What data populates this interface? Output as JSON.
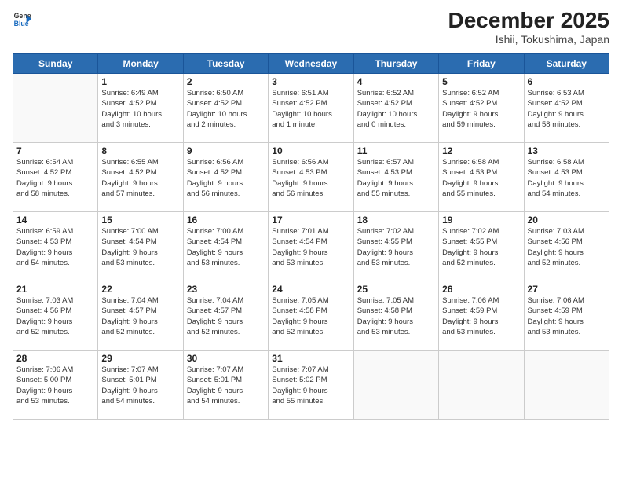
{
  "logo": {
    "line1": "General",
    "line2": "Blue",
    "icon": "▶"
  },
  "title": "December 2025",
  "subtitle": "Ishii, Tokushima, Japan",
  "days_of_week": [
    "Sunday",
    "Monday",
    "Tuesday",
    "Wednesday",
    "Thursday",
    "Friday",
    "Saturday"
  ],
  "weeks": [
    [
      {
        "day": "",
        "info": ""
      },
      {
        "day": "1",
        "info": "Sunrise: 6:49 AM\nSunset: 4:52 PM\nDaylight: 10 hours\nand 3 minutes."
      },
      {
        "day": "2",
        "info": "Sunrise: 6:50 AM\nSunset: 4:52 PM\nDaylight: 10 hours\nand 2 minutes."
      },
      {
        "day": "3",
        "info": "Sunrise: 6:51 AM\nSunset: 4:52 PM\nDaylight: 10 hours\nand 1 minute."
      },
      {
        "day": "4",
        "info": "Sunrise: 6:52 AM\nSunset: 4:52 PM\nDaylight: 10 hours\nand 0 minutes."
      },
      {
        "day": "5",
        "info": "Sunrise: 6:52 AM\nSunset: 4:52 PM\nDaylight: 9 hours\nand 59 minutes."
      },
      {
        "day": "6",
        "info": "Sunrise: 6:53 AM\nSunset: 4:52 PM\nDaylight: 9 hours\nand 58 minutes."
      }
    ],
    [
      {
        "day": "7",
        "info": "Sunrise: 6:54 AM\nSunset: 4:52 PM\nDaylight: 9 hours\nand 58 minutes."
      },
      {
        "day": "8",
        "info": "Sunrise: 6:55 AM\nSunset: 4:52 PM\nDaylight: 9 hours\nand 57 minutes."
      },
      {
        "day": "9",
        "info": "Sunrise: 6:56 AM\nSunset: 4:52 PM\nDaylight: 9 hours\nand 56 minutes."
      },
      {
        "day": "10",
        "info": "Sunrise: 6:56 AM\nSunset: 4:53 PM\nDaylight: 9 hours\nand 56 minutes."
      },
      {
        "day": "11",
        "info": "Sunrise: 6:57 AM\nSunset: 4:53 PM\nDaylight: 9 hours\nand 55 minutes."
      },
      {
        "day": "12",
        "info": "Sunrise: 6:58 AM\nSunset: 4:53 PM\nDaylight: 9 hours\nand 55 minutes."
      },
      {
        "day": "13",
        "info": "Sunrise: 6:58 AM\nSunset: 4:53 PM\nDaylight: 9 hours\nand 54 minutes."
      }
    ],
    [
      {
        "day": "14",
        "info": "Sunrise: 6:59 AM\nSunset: 4:53 PM\nDaylight: 9 hours\nand 54 minutes."
      },
      {
        "day": "15",
        "info": "Sunrise: 7:00 AM\nSunset: 4:54 PM\nDaylight: 9 hours\nand 53 minutes."
      },
      {
        "day": "16",
        "info": "Sunrise: 7:00 AM\nSunset: 4:54 PM\nDaylight: 9 hours\nand 53 minutes."
      },
      {
        "day": "17",
        "info": "Sunrise: 7:01 AM\nSunset: 4:54 PM\nDaylight: 9 hours\nand 53 minutes."
      },
      {
        "day": "18",
        "info": "Sunrise: 7:02 AM\nSunset: 4:55 PM\nDaylight: 9 hours\nand 53 minutes."
      },
      {
        "day": "19",
        "info": "Sunrise: 7:02 AM\nSunset: 4:55 PM\nDaylight: 9 hours\nand 52 minutes."
      },
      {
        "day": "20",
        "info": "Sunrise: 7:03 AM\nSunset: 4:56 PM\nDaylight: 9 hours\nand 52 minutes."
      }
    ],
    [
      {
        "day": "21",
        "info": "Sunrise: 7:03 AM\nSunset: 4:56 PM\nDaylight: 9 hours\nand 52 minutes."
      },
      {
        "day": "22",
        "info": "Sunrise: 7:04 AM\nSunset: 4:57 PM\nDaylight: 9 hours\nand 52 minutes."
      },
      {
        "day": "23",
        "info": "Sunrise: 7:04 AM\nSunset: 4:57 PM\nDaylight: 9 hours\nand 52 minutes."
      },
      {
        "day": "24",
        "info": "Sunrise: 7:05 AM\nSunset: 4:58 PM\nDaylight: 9 hours\nand 52 minutes."
      },
      {
        "day": "25",
        "info": "Sunrise: 7:05 AM\nSunset: 4:58 PM\nDaylight: 9 hours\nand 53 minutes."
      },
      {
        "day": "26",
        "info": "Sunrise: 7:06 AM\nSunset: 4:59 PM\nDaylight: 9 hours\nand 53 minutes."
      },
      {
        "day": "27",
        "info": "Sunrise: 7:06 AM\nSunset: 4:59 PM\nDaylight: 9 hours\nand 53 minutes."
      }
    ],
    [
      {
        "day": "28",
        "info": "Sunrise: 7:06 AM\nSunset: 5:00 PM\nDaylight: 9 hours\nand 53 minutes."
      },
      {
        "day": "29",
        "info": "Sunrise: 7:07 AM\nSunset: 5:01 PM\nDaylight: 9 hours\nand 54 minutes."
      },
      {
        "day": "30",
        "info": "Sunrise: 7:07 AM\nSunset: 5:01 PM\nDaylight: 9 hours\nand 54 minutes."
      },
      {
        "day": "31",
        "info": "Sunrise: 7:07 AM\nSunset: 5:02 PM\nDaylight: 9 hours\nand 55 minutes."
      },
      {
        "day": "",
        "info": ""
      },
      {
        "day": "",
        "info": ""
      },
      {
        "day": "",
        "info": ""
      }
    ]
  ]
}
